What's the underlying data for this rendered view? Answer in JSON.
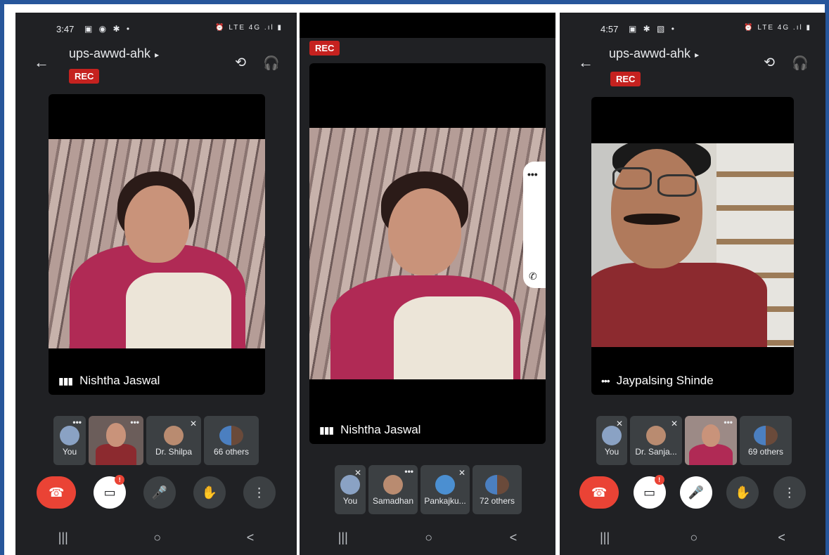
{
  "phone1": {
    "status": {
      "time": "3:47",
      "left_icons": "▣ ◉ ✱ •",
      "right_icons": "⏰ LTE 4G .ıl ▮"
    },
    "meeting_title": "ups-awwd-ahk",
    "rec": "REC",
    "speaker": "Nishtha Jaswal",
    "thumbs": [
      {
        "label": "You"
      },
      {
        "label": ""
      },
      {
        "label": "Dr. Shilpa"
      },
      {
        "label": "66 others"
      }
    ],
    "badge": "!"
  },
  "phone2": {
    "rec": "REC",
    "speaker": "Nishtha Jaswal",
    "thumbs": [
      {
        "label": "You"
      },
      {
        "label": "Samadhan"
      },
      {
        "label": "Pankajku..."
      },
      {
        "label": "72 others"
      }
    ]
  },
  "phone3": {
    "status": {
      "time": "4:57",
      "left_icons": "▣ ✱ ▧ •",
      "right_icons": "⏰ LTE 4G .ıl ▮"
    },
    "meeting_title": "ups-awwd-ahk",
    "rec": "REC",
    "speaker": "Jaypalsing Shinde",
    "thumbs": [
      {
        "label": "You"
      },
      {
        "label": "Dr. Sanja..."
      },
      {
        "label": ""
      },
      {
        "label": "69 others"
      }
    ],
    "badge": "!"
  },
  "icons": {
    "back": "←",
    "caret": "▸",
    "switch_camera": "⟲",
    "audio": "🎧",
    "end_call": "☎",
    "camera_off": "▭",
    "mic": "🎤",
    "hand": "✋",
    "more": "⋮",
    "nav_recent": "|||",
    "nav_home": "○",
    "nav_back": "<"
  },
  "colors": {
    "frame": "#27569b",
    "end_call": "#ea4335",
    "rec": "#c5221f",
    "background": "#202124"
  }
}
